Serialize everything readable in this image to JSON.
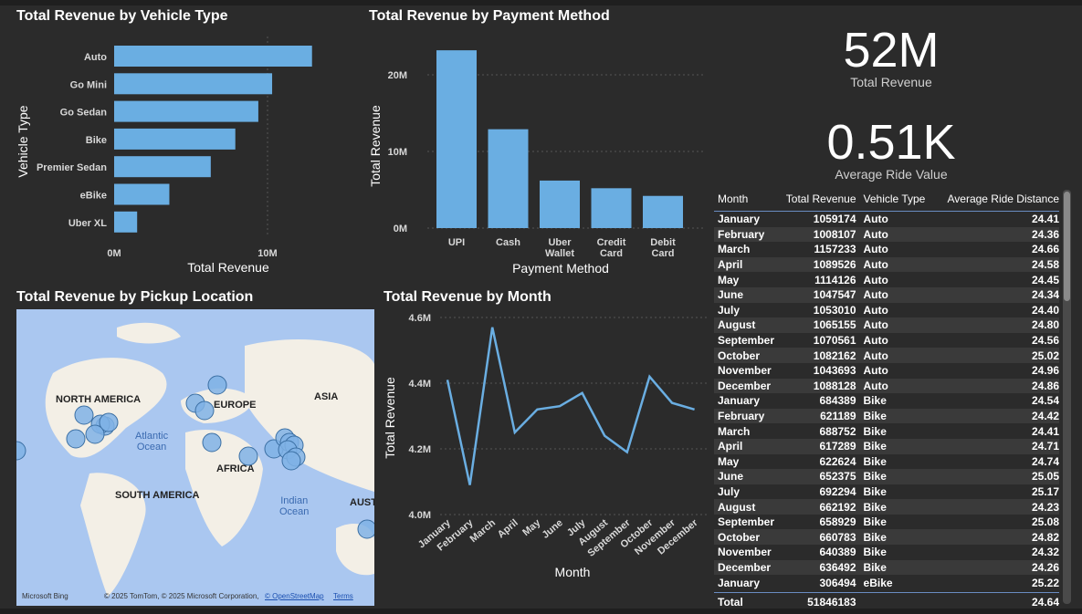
{
  "vehicle_chart": {
    "title": "Total Revenue by Vehicle Type",
    "xlabel": "Total Revenue",
    "ylabel": "Vehicle Type",
    "ticks": [
      "0M",
      "10M"
    ]
  },
  "payment_chart": {
    "title": "Total Revenue by Payment Method",
    "xlabel": "Payment Method",
    "ylabel": "Total Revenue",
    "ticks": [
      "0M",
      "10M",
      "20M"
    ]
  },
  "month_chart": {
    "title": "Total Revenue by Month",
    "xlabel": "Month",
    "ylabel": "Total Revenue",
    "ticks": [
      "4.0M",
      "4.2M",
      "4.4M",
      "4.6M"
    ]
  },
  "map": {
    "title": "Total Revenue by Pickup Location",
    "labels": [
      "NORTH AMERICA",
      "EUROPE",
      "ASIA",
      "AFRICA",
      "SOUTH AMERICA",
      "AUST"
    ],
    "oceans": [
      "Atlantic\nOcean",
      "Indian\nOcean"
    ],
    "bing": "Microsoft Bing",
    "copyright": "© 2025 TomTom, © 2025 Microsoft Corporation,",
    "osm": "© OpenStreetMap",
    "terms": "Terms"
  },
  "kpis": {
    "total_revenue": {
      "value": "52M",
      "label": "Total Revenue"
    },
    "avg_ride": {
      "value": "0.51K",
      "label": "Average Ride Value"
    }
  },
  "table": {
    "headers": [
      "Month",
      "Total Revenue",
      "Vehicle Type",
      "Average Ride Distance"
    ],
    "rows": [
      [
        "January",
        "1059174",
        "Auto",
        "24.41"
      ],
      [
        "February",
        "1008107",
        "Auto",
        "24.36"
      ],
      [
        "March",
        "1157233",
        "Auto",
        "24.66"
      ],
      [
        "April",
        "1089526",
        "Auto",
        "24.58"
      ],
      [
        "May",
        "1114126",
        "Auto",
        "24.45"
      ],
      [
        "June",
        "1047547",
        "Auto",
        "24.34"
      ],
      [
        "July",
        "1053010",
        "Auto",
        "24.40"
      ],
      [
        "August",
        "1065155",
        "Auto",
        "24.80"
      ],
      [
        "September",
        "1070561",
        "Auto",
        "24.56"
      ],
      [
        "October",
        "1082162",
        "Auto",
        "25.02"
      ],
      [
        "November",
        "1043693",
        "Auto",
        "24.96"
      ],
      [
        "December",
        "1088128",
        "Auto",
        "24.86"
      ],
      [
        "January",
        "684389",
        "Bike",
        "24.54"
      ],
      [
        "February",
        "621189",
        "Bike",
        "24.42"
      ],
      [
        "March",
        "688752",
        "Bike",
        "24.41"
      ],
      [
        "April",
        "617289",
        "Bike",
        "24.71"
      ],
      [
        "May",
        "622624",
        "Bike",
        "24.74"
      ],
      [
        "June",
        "652375",
        "Bike",
        "25.05"
      ],
      [
        "July",
        "692294",
        "Bike",
        "25.17"
      ],
      [
        "August",
        "662192",
        "Bike",
        "24.23"
      ],
      [
        "September",
        "658929",
        "Bike",
        "25.08"
      ],
      [
        "October",
        "660783",
        "Bike",
        "24.82"
      ],
      [
        "November",
        "640389",
        "Bike",
        "24.32"
      ],
      [
        "December",
        "636492",
        "Bike",
        "24.26"
      ],
      [
        "January",
        "306494",
        "eBike",
        "25.22"
      ]
    ],
    "total": [
      "Total",
      "51846183",
      "",
      "24.64"
    ]
  },
  "colors": {
    "bar": "#6aaee2",
    "line": "#6aaee2",
    "bg": "#2b2b2b",
    "map": "#aac7f0"
  },
  "chart_data": [
    {
      "type": "bar",
      "orientation": "horizontal",
      "title": "Total Revenue by Vehicle Type",
      "categories": [
        "Auto",
        "Go Mini",
        "Go Sedan",
        "Bike",
        "Premier Sedan",
        "eBike",
        "Uber XL"
      ],
      "values": [
        12.9,
        10.3,
        9.4,
        7.9,
        6.3,
        3.6,
        1.5
      ],
      "unit": "M",
      "xlim": [
        0,
        13
      ],
      "xlabel": "Total Revenue",
      "ylabel": "Vehicle Type"
    },
    {
      "type": "bar",
      "title": "Total Revenue by Payment Method",
      "categories": [
        "UPI",
        "Cash",
        "Uber Wallet",
        "Credit Card",
        "Debit Card"
      ],
      "values": [
        23.2,
        12.9,
        6.2,
        5.2,
        4.2
      ],
      "unit": "M",
      "ylim": [
        0,
        25
      ],
      "xlabel": "Payment Method",
      "ylabel": "Total Revenue"
    },
    {
      "type": "line",
      "title": "Total Revenue by Month",
      "categories": [
        "January",
        "February",
        "March",
        "April",
        "May",
        "June",
        "July",
        "August",
        "September",
        "October",
        "November",
        "December"
      ],
      "values": [
        4.41,
        4.09,
        4.57,
        4.25,
        4.32,
        4.33,
        4.37,
        4.24,
        4.19,
        4.42,
        4.34,
        4.32
      ],
      "unit": "M",
      "ylim": [
        4.0,
        4.6
      ],
      "xlabel": "Month",
      "ylabel": "Total Revenue"
    }
  ]
}
